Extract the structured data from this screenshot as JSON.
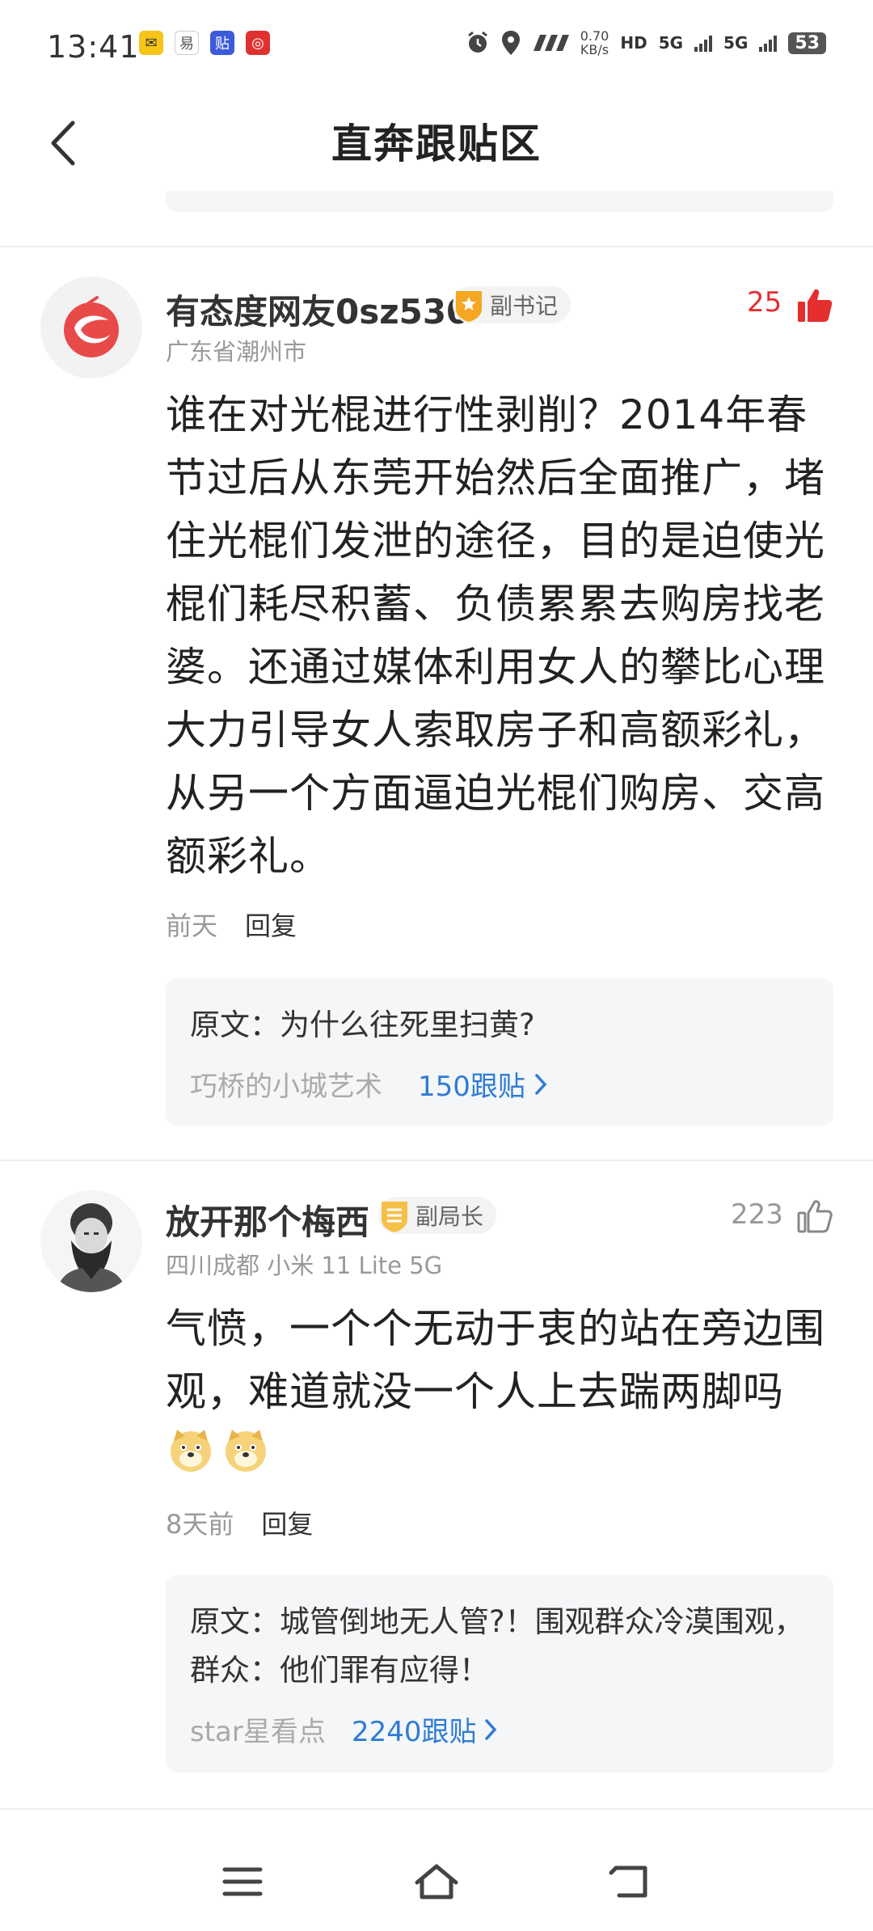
{
  "status_bar": {
    "time": "13:41",
    "net_speed_value": "0.70",
    "net_speed_unit": "KB/s",
    "hd_tag": "HD",
    "sim1": "5G",
    "sim2": "5G",
    "battery": "53"
  },
  "header": {
    "title": "直奔跟贴区",
    "back_icon": "chevron-left-icon"
  },
  "comments": [
    {
      "username": "有态度网友0sz530",
      "badge": "副书记",
      "likes": "25",
      "liked": true,
      "location": "广东省潮州市",
      "text": "谁在对光棍进行性剥削？2014年春节过后从东莞开始然后全面推广，堵住光棍们发泄的途径，目的是迫使光棍们耗尽积蓄、负债累累去购房找老婆。还通过媒体利用女人的攀比心理大力引导女人索取房子和高额彩礼，从另一个方面逼迫光棍们购房、交高额彩礼。",
      "time": "前天",
      "reply": "回复",
      "original": {
        "title": "原文：为什么往死里扫黄?",
        "author": "巧桥的小城艺术",
        "count": "150跟贴"
      }
    },
    {
      "username": "放开那个梅西",
      "badge": "副局长",
      "likes": "223",
      "liked": false,
      "location": "四川成都 小米 11 Lite 5G",
      "text": "气愤，一个个无动于衷的站在旁边围观，难道就没一个人上去踹两脚吗",
      "time": "8天前",
      "reply": "回复",
      "original": {
        "title": "原文：城管倒地无人管?！围观群众冷漠围观，群众：他们罪有应得！",
        "author": "star星看点",
        "count": "2240跟贴"
      }
    }
  ],
  "colors": {
    "liked_red": "#e52e2e",
    "link_blue": "#2f7bd3",
    "card_bg": "#f4f6f8",
    "badge_gold": "#f5a623"
  }
}
